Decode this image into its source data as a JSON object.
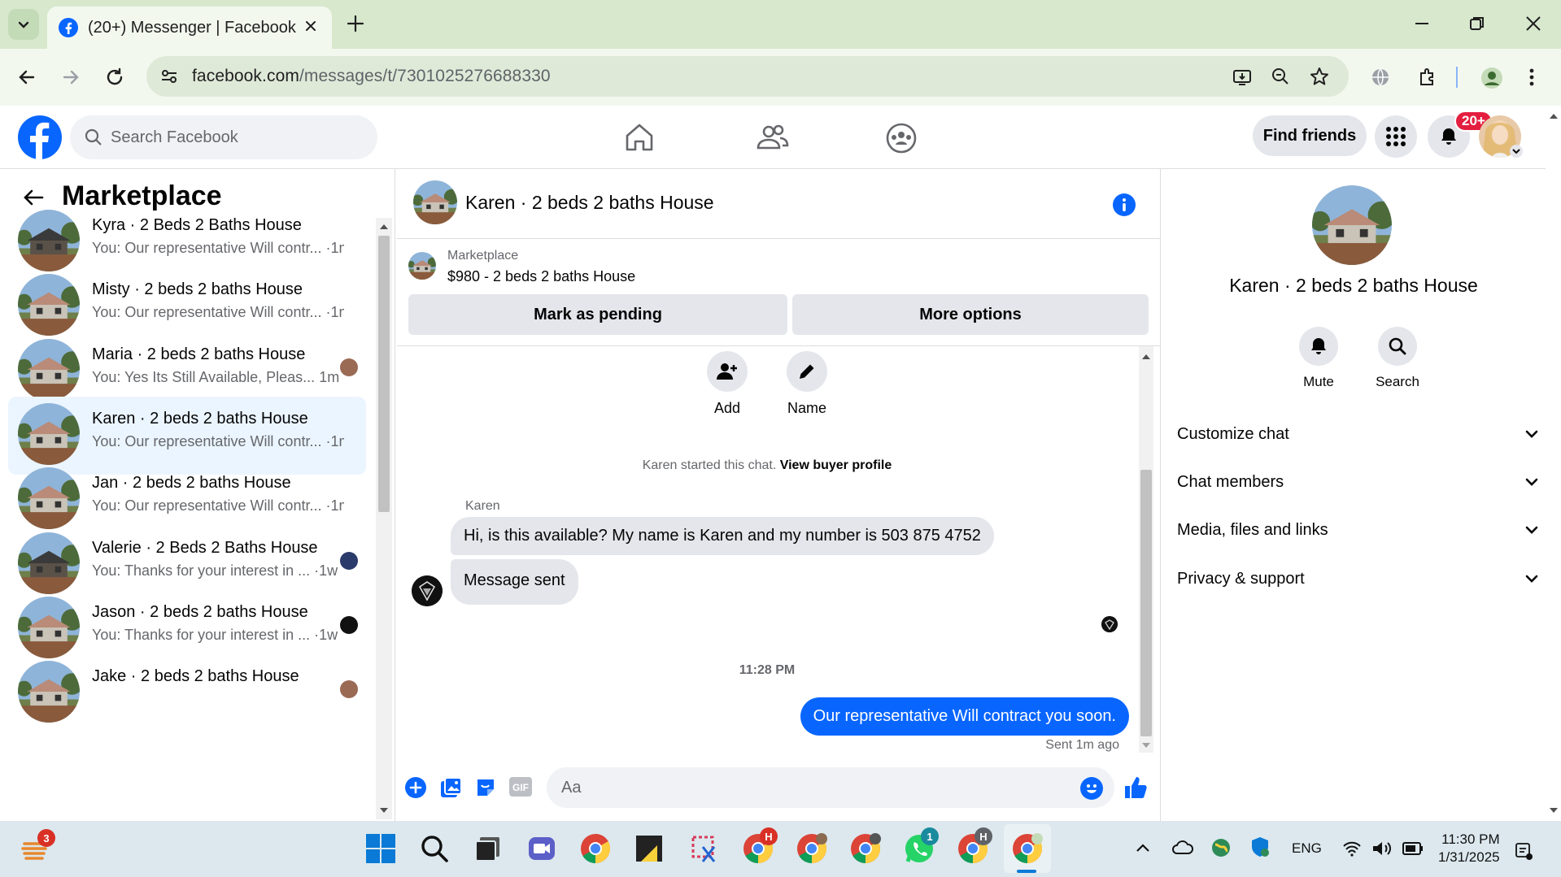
{
  "browser": {
    "tab_title": "(20+) Messenger | Facebook",
    "url_host": "facebook.com",
    "url_path": "/messages/t/7301025276688330"
  },
  "fb": {
    "search_placeholder": "Search Facebook",
    "find_friends": "Find friends",
    "notif_badge": "20+"
  },
  "sidebar": {
    "title": "Marketplace",
    "conversations": [
      {
        "name": "Kyra · 2 Beds 2 Baths House",
        "preview": "You: Our representative Will contr...",
        "time": "·1m"
      },
      {
        "name": "Misty · 2 beds 2 baths House",
        "preview": "You: Our representative Will contr...",
        "time": "·1m"
      },
      {
        "name": "Maria · 2 beds 2 baths House",
        "preview": "You: Yes Its Still Available, Pleas...",
        "time": "1m"
      },
      {
        "name": "Karen · 2 beds 2 baths House",
        "preview": "You: Our representative Will contr...",
        "time": "·1m"
      },
      {
        "name": "Jan · 2 beds 2 baths House",
        "preview": "You: Our representative Will contr...",
        "time": "·1m"
      },
      {
        "name": "Valerie · 2 Beds 2 Baths House",
        "preview": "You: Thanks for your interest in ...",
        "time": "·1w"
      },
      {
        "name": "Jason · 2 beds 2 baths House",
        "preview": "You: Thanks for your interest in ...",
        "time": "·1w"
      },
      {
        "name": "Jake · 2 beds 2 baths House",
        "preview": "",
        "time": ""
      }
    ]
  },
  "chat": {
    "title": "Karen · 2 beds 2 baths House",
    "listing_category": "Marketplace",
    "listing_desc": "$980 - 2 beds 2 baths House",
    "mark_pending": "Mark as pending",
    "more_options": "More options",
    "add_label": "Add",
    "name_label": "Name",
    "started_text": "Karen started this chat.",
    "view_profile": "View buyer profile",
    "sender": "Karen",
    "msg1": "Hi, is this available?  My name is Karen and my number is 503 875 4752",
    "msg2": "Message sent",
    "timestamp": "11:28 PM",
    "msg3": "Our representative Will contract you soon.",
    "sent_status": "Sent 1m ago",
    "composer_placeholder": "Aa"
  },
  "details": {
    "name": "Karen · 2 beds 2 baths House",
    "mute": "Mute",
    "search": "Search",
    "sections": [
      "Customize chat",
      "Chat members",
      "Media, files and links",
      "Privacy & support"
    ]
  },
  "taskbar": {
    "lang": "ENG",
    "time": "11:30 PM",
    "date": "1/31/2025",
    "badges": {
      "weather": "3",
      "chrome_h1": "H",
      "whatsapp": "1",
      "chrome_h2": "H"
    }
  },
  "colors": {
    "fb_blue": "#0866ff",
    "badge_red": "#e41e3f",
    "tab_green": "#d7e8cd"
  }
}
